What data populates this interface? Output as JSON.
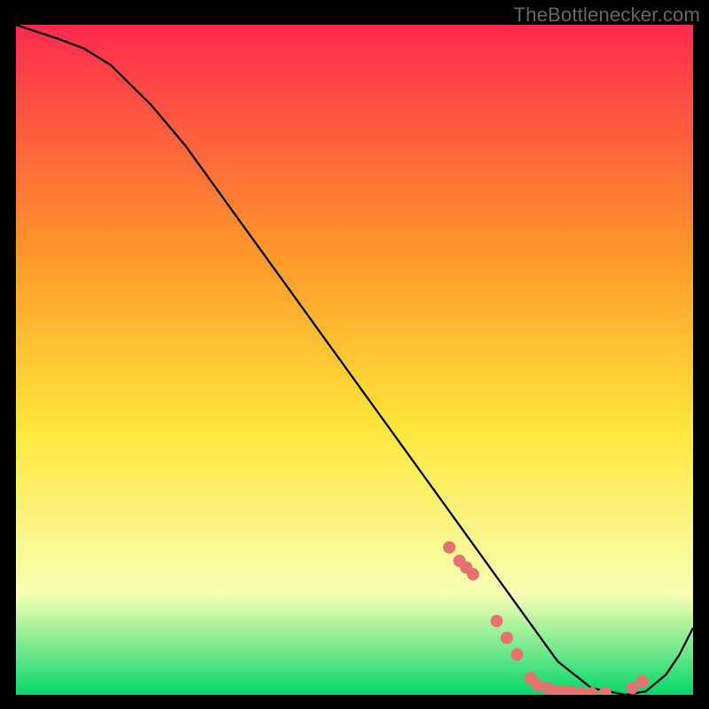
{
  "watermark": "TheBottlenecker.com",
  "chart_data": {
    "type": "line",
    "title": "",
    "xlabel": "",
    "ylabel": "",
    "xlim": [
      0,
      100
    ],
    "ylim": [
      0,
      100
    ],
    "grid": false,
    "gradient": {
      "top": "#ff2a4f",
      "upper_mid": "#ff9a2a",
      "mid": "#ffe63a",
      "lower_mid": "#f6ffb5",
      "bottom": "#05d76a"
    },
    "series": [
      {
        "name": "curve",
        "x": [
          0,
          3,
          6,
          10,
          14,
          20,
          25,
          30,
          35,
          40,
          45,
          50,
          55,
          60,
          65,
          70,
          75,
          80,
          85,
          90,
          93,
          96,
          98,
          100
        ],
        "y": [
          100,
          99,
          98,
          96.5,
          94,
          88,
          82,
          75,
          68,
          61,
          54,
          47,
          40,
          33,
          26,
          19,
          12,
          5,
          1,
          0,
          0.5,
          3,
          6,
          10
        ]
      }
    ],
    "markers": {
      "name": "highlight-points",
      "color": "#e6716f",
      "radius": 7,
      "x": [
        64,
        65.5,
        66.5,
        67.5,
        71,
        72.5,
        74,
        76,
        77,
        78.5,
        80,
        81,
        82,
        83.5,
        85,
        87,
        91,
        92.5
      ],
      "y": [
        22,
        20,
        19,
        18,
        11,
        8.5,
        6,
        2.5,
        1.5,
        1,
        0.6,
        0.5,
        0.4,
        0.3,
        0.25,
        0.3,
        1,
        2
      ]
    }
  }
}
